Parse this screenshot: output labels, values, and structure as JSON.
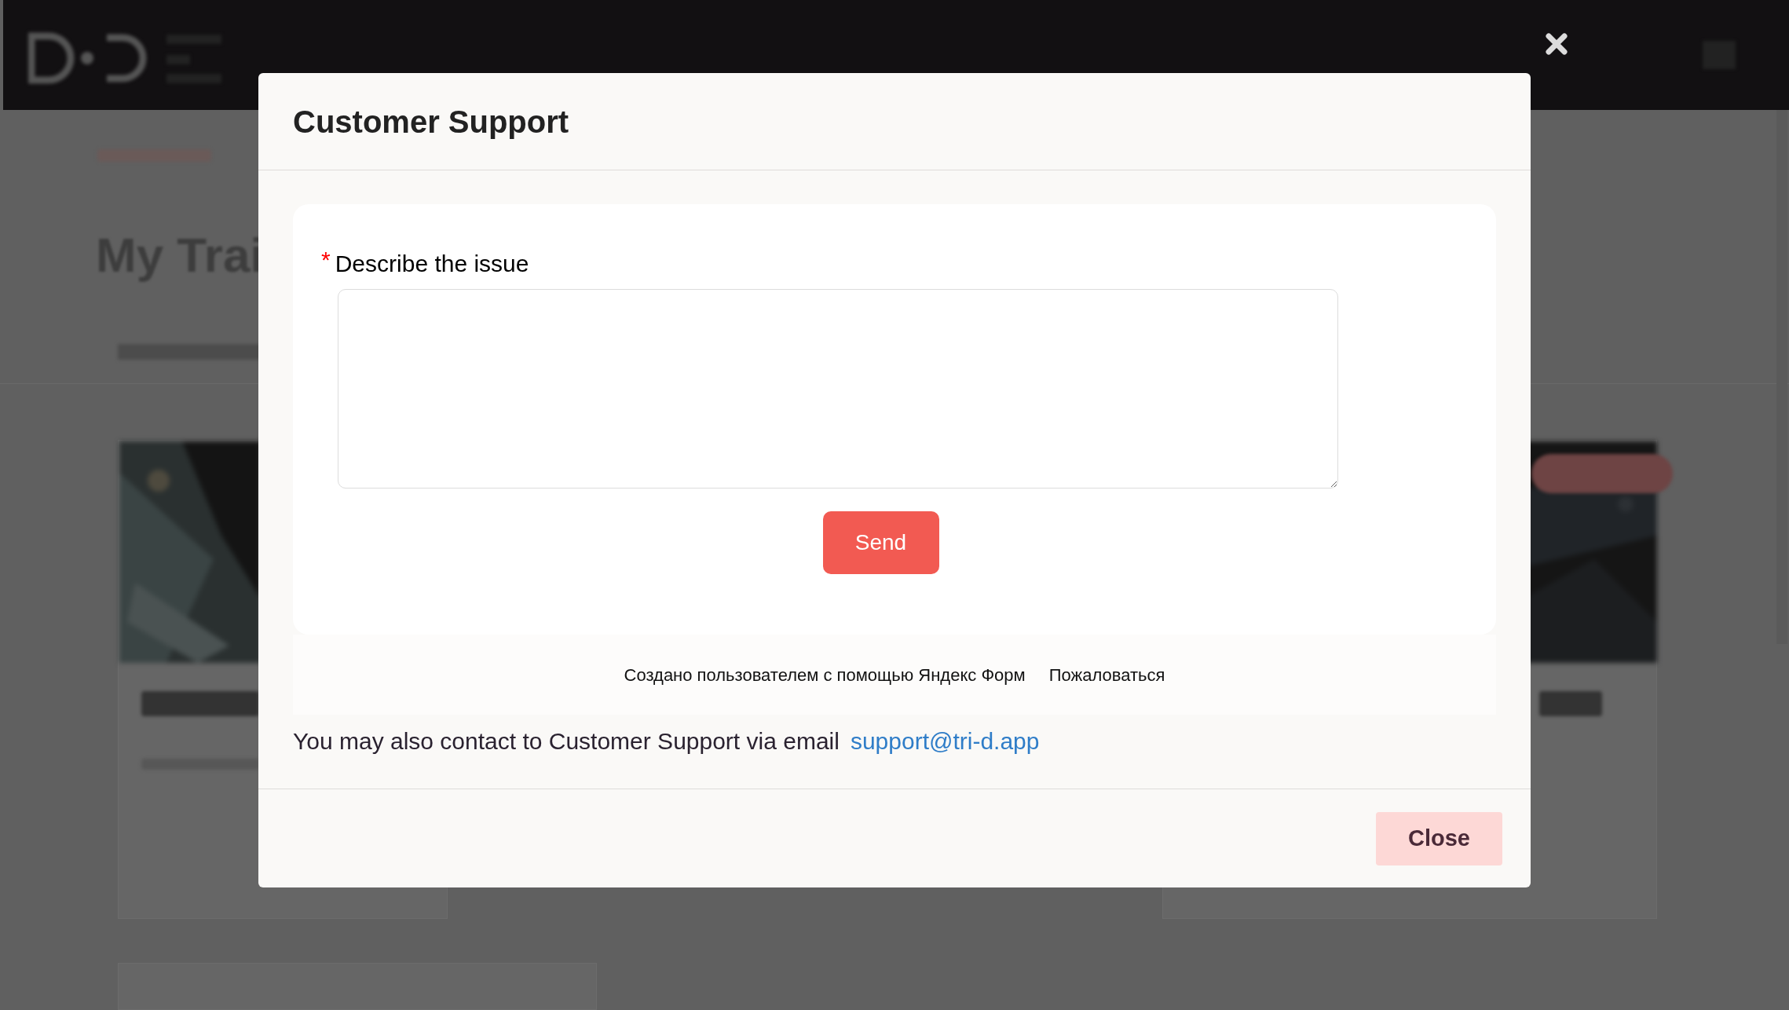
{
  "background_page": {
    "heading": "My Trai"
  },
  "modal": {
    "title": "Customer Support",
    "form": {
      "field_label": "Describe the issue",
      "required_mark": "*",
      "send_button": "Send",
      "footer_text": "Создано пользователем с помощью Яндекс Форм",
      "report_link": "Пожаловаться"
    },
    "contact_text": "You may also contact to Customer Support via email",
    "contact_email": "support@tri-d.app",
    "close_button": "Close"
  }
}
